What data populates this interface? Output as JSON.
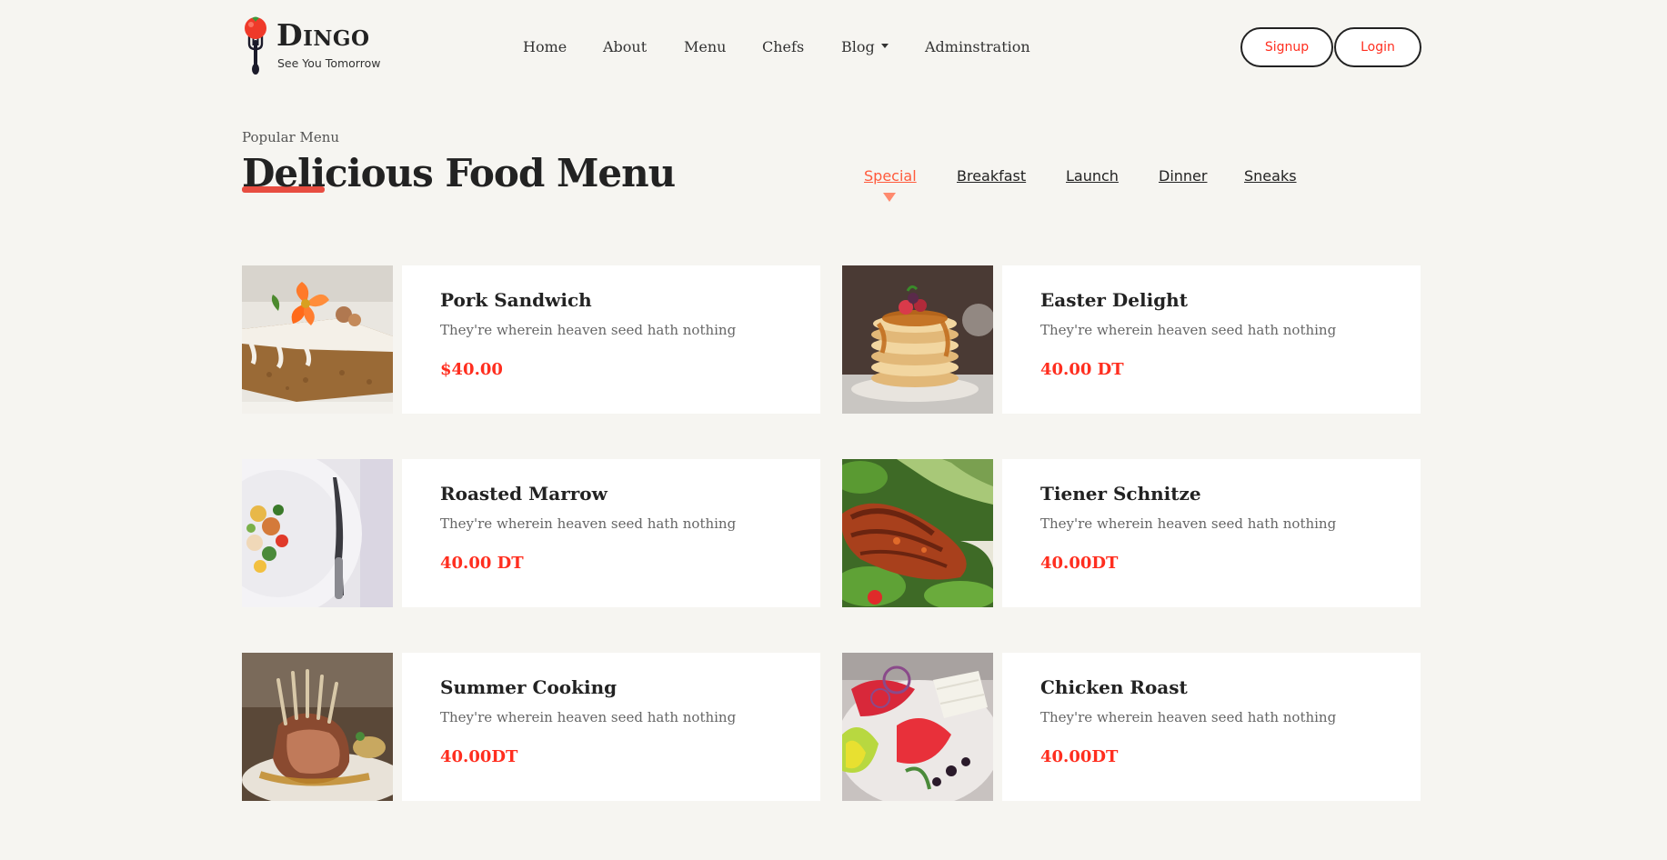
{
  "header": {
    "brand_name": "Dingo",
    "brand_tagline": "See You Tomorrow",
    "nav": [
      {
        "label": "Home"
      },
      {
        "label": "About"
      },
      {
        "label": "Menu"
      },
      {
        "label": "Chefs"
      },
      {
        "label": "Blog",
        "has_dropdown": true
      },
      {
        "label": "Adminstration"
      }
    ],
    "signup_label": "Signup",
    "login_label": "Login"
  },
  "section": {
    "subtitle": "Popular Menu",
    "title": "Delicious Food Menu",
    "tabs": [
      {
        "label": "Special",
        "active": true
      },
      {
        "label": "Breakfast",
        "active": false
      },
      {
        "label": "Launch",
        "active": false
      },
      {
        "label": "Dinner",
        "active": false
      },
      {
        "label": "Sneaks",
        "active": false
      }
    ]
  },
  "menu_items": [
    {
      "name": "Pork Sandwich",
      "description": "They're wherein heaven seed hath nothing",
      "price": "$40.00",
      "photo": "carrot-cake-photo"
    },
    {
      "name": "Easter Delight",
      "description": "They're wherein heaven seed hath nothing",
      "price": "40.00 DT",
      "photo": "pancakes-photo"
    },
    {
      "name": "Roasted Marrow",
      "description": "They're wherein heaven seed hath nothing",
      "price": "40.00 DT",
      "photo": "plated-salad-photo"
    },
    {
      "name": "Tiener Schnitze",
      "description": "They're wherein heaven seed hath nothing",
      "price": "40.00DT",
      "photo": "grilled-chicken-photo"
    },
    {
      "name": "Summer Cooking",
      "description": "They're wherein heaven seed hath nothing",
      "price": "40.00DT",
      "photo": "rack-of-lamb-photo"
    },
    {
      "name": "Chicken Roast",
      "description": "They're wherein heaven seed hath nothing",
      "price": "40.00DT",
      "photo": "greek-salad-photo"
    }
  ],
  "colors": {
    "background": "#f6f5f1",
    "accent": "#ff2e1f",
    "active_tab": "#ff5a3c",
    "card": "#ffffff",
    "text": "#222222"
  }
}
